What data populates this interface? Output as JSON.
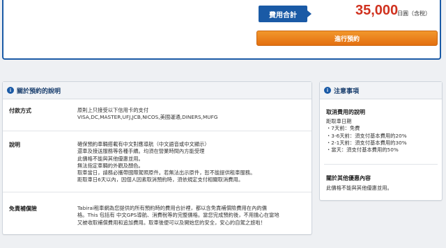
{
  "summary": {
    "fee_label": "費用合計",
    "price": "35,000",
    "price_unit": "日圓（含稅）",
    "reserve_button": "進行預約"
  },
  "about": {
    "title": "關於預約的說明",
    "rows": [
      {
        "label": "付款方式",
        "lines": [
          "原則上只接受以下信用卡的支付",
          "VISA,DC,MASTER,UFJ,JCB,NICOS,美國運通,DINERS,MUFG"
        ]
      },
      {
        "label": "說明",
        "lines": [
          "確保預約車輛搭載有中文對應導航（中文語音或中文顯示）",
          "還車及接送服務等各種手續。均須在營業時間內方能受理",
          "此價格不能與其他優惠並用。",
          "無法指定車輛的外觀及顏色。",
          "取車當日，請務必攜帶國際駕照原件。若無法出示原件，恕不能提供租車服務。",
          "距取車日6天以內，因個人因素取消預約時，須依規定支付相關取消費用。"
        ]
      },
      {
        "label": "免責補償險",
        "lines": [
          "Tabirai租車網為您提供的所有預約時的費用合計裡，都以含免責補償險費用在內的價",
          "格。This 包括有 中文GPS導航、消費稅等的完整價格。當您完成預約後，不用擔心在當地",
          "又被收取補償費用和追加費用。取車後便可以及開始您的安全，安心的自駕之旅啦！"
        ]
      }
    ]
  },
  "notes": {
    "title": "注意事項",
    "cancel_title": "取消費用的說明",
    "cancel_lines": [
      "距取車日期",
      "・7天前：免費",
      "・3-6天前：須支付基本費用的20%",
      "・2-1天前：須支付基本費用的30%",
      "・當天：須支付基本費用的50%"
    ],
    "other_title": "關於其他優惠內容",
    "other_text": "此價格不能與其他優惠並用。"
  },
  "icons": {
    "info": "i"
  },
  "colors": {
    "brand_blue": "#1a5aa6",
    "price_red": "#d0321f",
    "button_orange": "#e36f10"
  }
}
